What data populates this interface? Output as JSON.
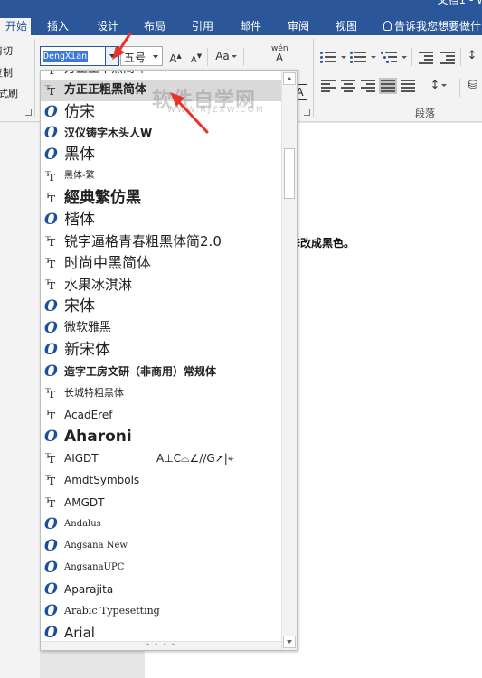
{
  "window": {
    "title": "文档1 - W"
  },
  "tabs": [
    {
      "label": "开始",
      "active": true
    },
    {
      "label": "插入"
    },
    {
      "label": "设计"
    },
    {
      "label": "布局"
    },
    {
      "label": "引用"
    },
    {
      "label": "邮件"
    },
    {
      "label": "审阅"
    },
    {
      "label": "视图"
    }
  ],
  "tell_me": "告诉我您想要做什",
  "clipboard": {
    "cut": "剪切",
    "copy": "复制",
    "format_painter": "格式刷"
  },
  "font_group": {
    "font_name": "DengXian",
    "font_size": "五号",
    "grow": "A",
    "shrink": "A",
    "change_case": "Aa",
    "phonetic_top": "wén",
    "phonetic_bottom": "A",
    "char_border": "A"
  },
  "paragraph_group": {
    "label": "段落"
  },
  "document": {
    "visible_text": "修改成黑色。"
  },
  "watermark": {
    "main": "软件自学网",
    "sub": "WWW.RJZXW.COM"
  },
  "font_list": [
    {
      "name": "方正正中黑简体",
      "icon": "truetype-icon"
    },
    {
      "name": "方正正粗黑简体",
      "icon": "truetype-icon",
      "highlighted": true
    },
    {
      "name": "仿宋",
      "icon": "opentype-icon"
    },
    {
      "name": "汉仪铸字木头人W",
      "icon": "opentype-icon"
    },
    {
      "name": "黑体",
      "icon": "opentype-icon"
    },
    {
      "name": "黑体-繁",
      "icon": "truetype-icon"
    },
    {
      "name": "經典繁仿黑",
      "icon": "truetype-icon"
    },
    {
      "name": "楷体",
      "icon": "opentype-icon"
    },
    {
      "name": "锐字逼格青春粗黑体简2.0",
      "icon": "truetype-icon"
    },
    {
      "name": "时尚中黑简体",
      "icon": "truetype-icon"
    },
    {
      "name": "水果冰淇淋",
      "icon": "truetype-icon"
    },
    {
      "name": "宋体",
      "icon": "opentype-icon"
    },
    {
      "name": "微软雅黑",
      "icon": "opentype-icon"
    },
    {
      "name": "新宋体",
      "icon": "opentype-icon"
    },
    {
      "name": "造字工房文研（非商用）常规体",
      "icon": "opentype-icon"
    },
    {
      "name": "长城特粗黑体",
      "icon": "truetype-icon"
    },
    {
      "name": "AcadEref",
      "icon": "truetype-icon"
    },
    {
      "name": "Aharoni",
      "icon": "opentype-icon"
    },
    {
      "name": "AIGDT",
      "icon": "truetype-icon",
      "sample": "A⊥C⌓∠//G↗|⌖"
    },
    {
      "name": "AmdtSymbols",
      "icon": "truetype-icon"
    },
    {
      "name": "AMGDT",
      "icon": "truetype-icon"
    },
    {
      "name": "Andalus",
      "icon": "opentype-icon"
    },
    {
      "name": "Angsana New",
      "icon": "opentype-icon"
    },
    {
      "name": "AngsanaUPC",
      "icon": "opentype-icon"
    },
    {
      "name": "Aparajita",
      "icon": "opentype-icon"
    },
    {
      "name": "Arabic Typesetting",
      "icon": "opentype-icon"
    },
    {
      "name": "Arial",
      "icon": "opentype-icon"
    }
  ],
  "colors": {
    "ribbon_blue": "#2b579a",
    "selection": "#3c78d8",
    "arrow_red": "#e8332a"
  }
}
